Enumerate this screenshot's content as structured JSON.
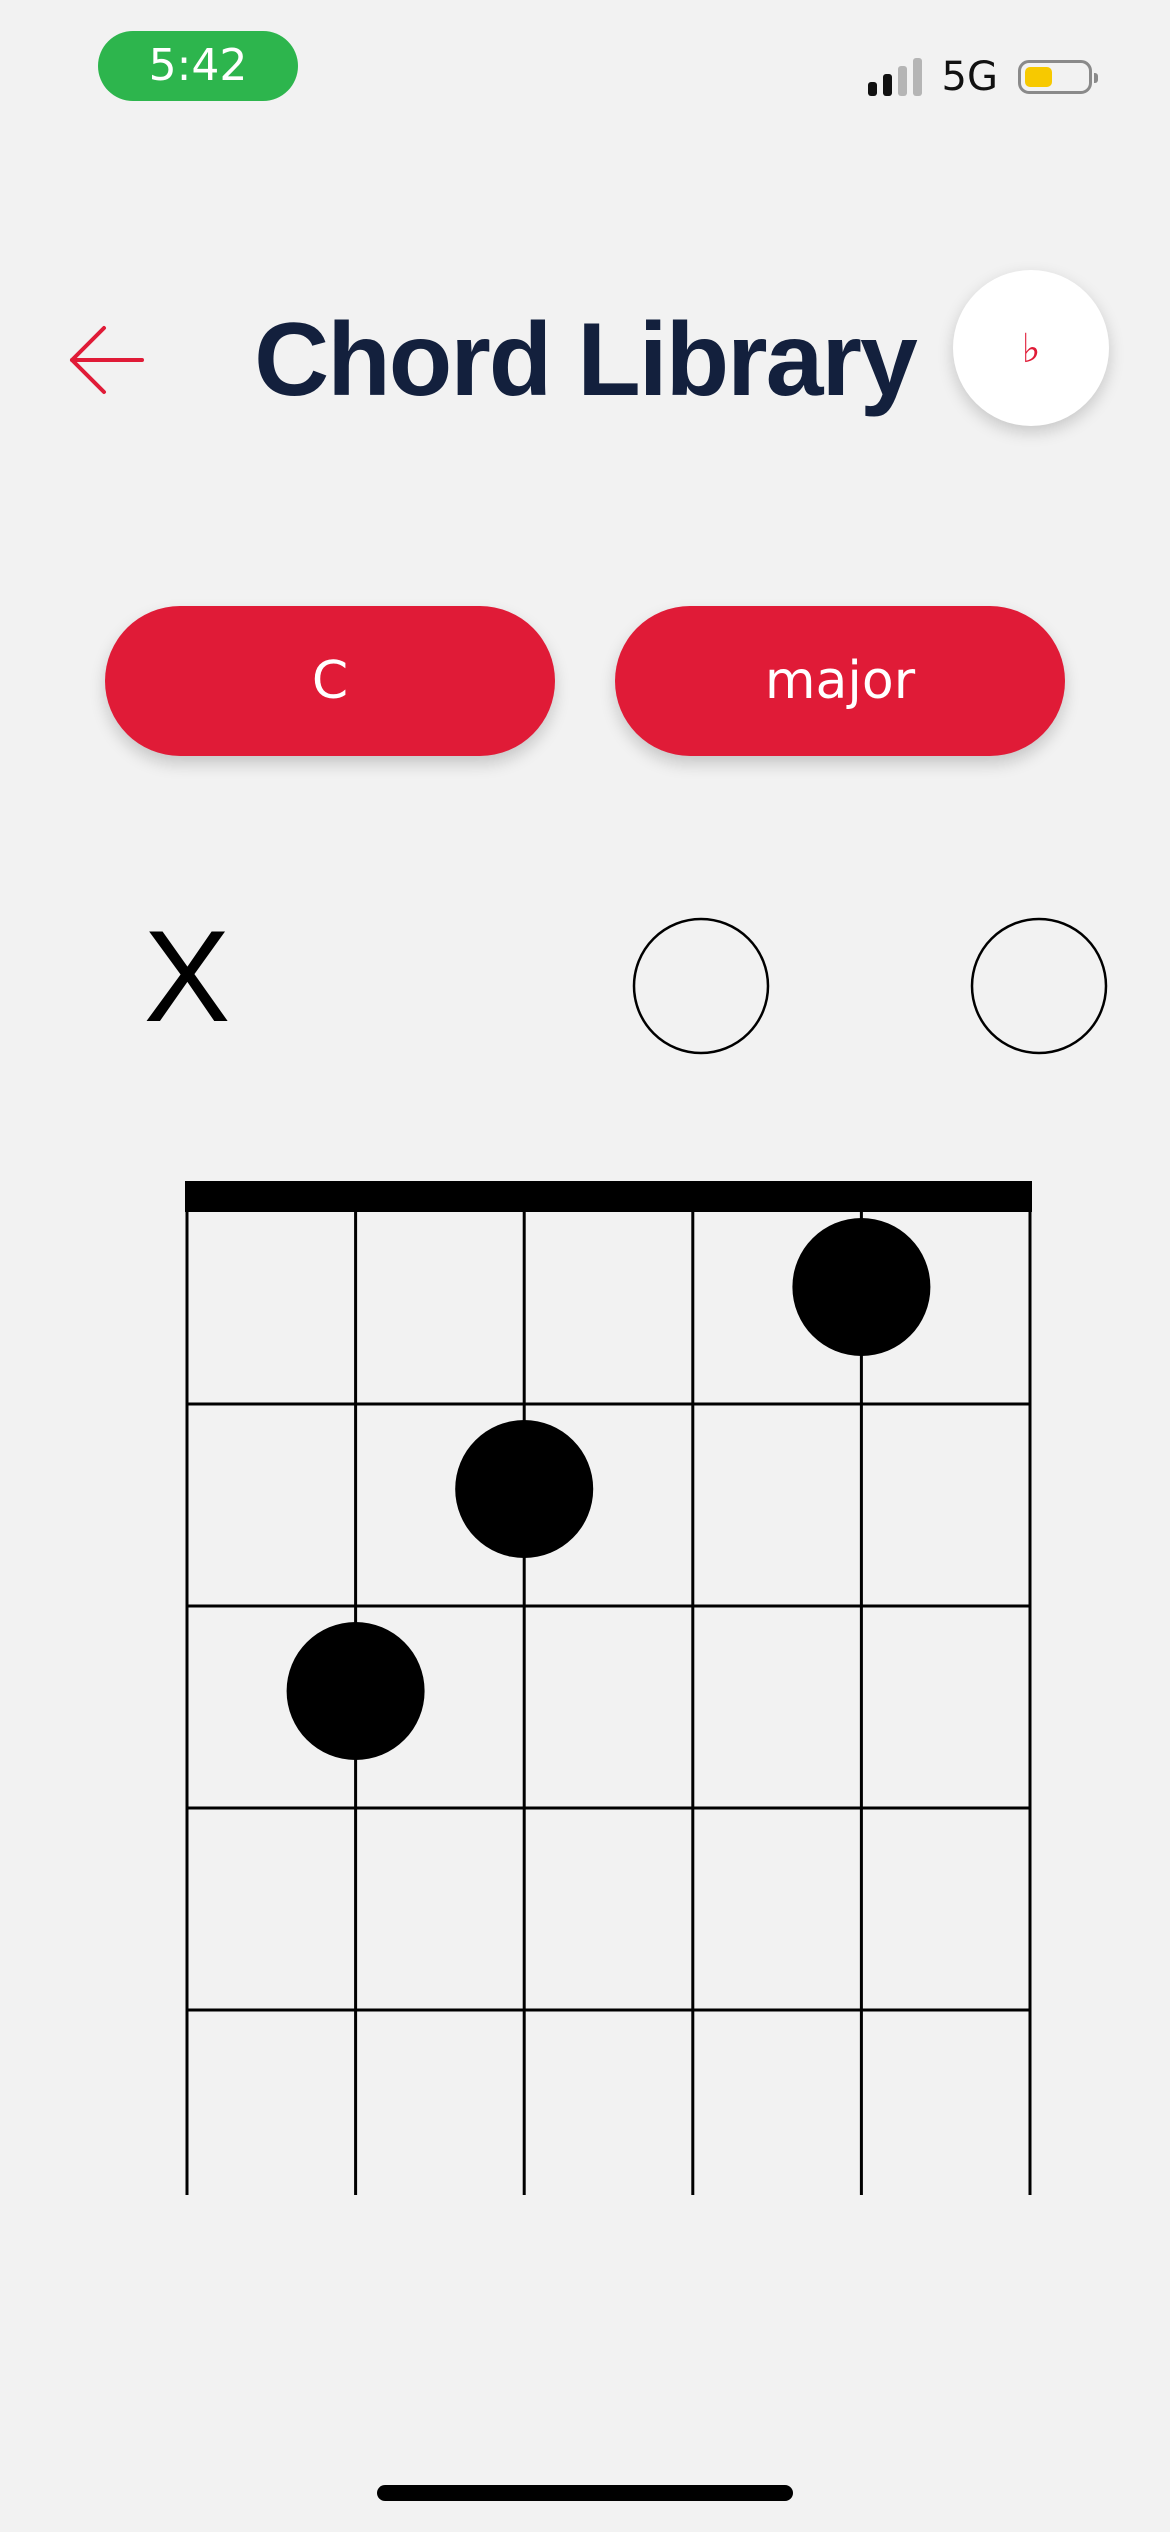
{
  "status_bar": {
    "time": "5:42",
    "network": "5G",
    "battery_fraction": 0.45,
    "signal_bars_active": 2,
    "signal_bars_total": 4,
    "colors": {
      "time_pill": "#2db54d",
      "battery_fill": "#f7c900",
      "signal_active": "#111111",
      "signal_inactive": "#b5b5b5"
    }
  },
  "header": {
    "title": "Chord Library",
    "back_icon": "arrow-left-icon",
    "accidental_label": "♭"
  },
  "pickers": {
    "root": "C",
    "quality": "major"
  },
  "chord_diagram": {
    "strings": 6,
    "frets_shown": 5,
    "string_markers": [
      "X",
      "",
      "",
      "O",
      "",
      "O"
    ],
    "fingers": [
      {
        "string": 2,
        "fret": 3
      },
      {
        "string": 3,
        "fret": 2
      },
      {
        "string": 5,
        "fret": 1
      }
    ]
  },
  "colors": {
    "accent": "#e01b37",
    "title": "#13203d",
    "background": "#f2f2f2"
  }
}
